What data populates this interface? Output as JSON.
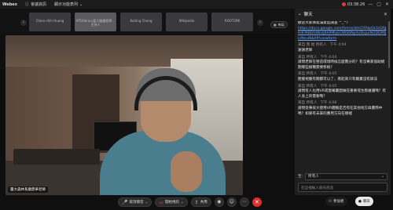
{
  "app": {
    "logo": "Webex",
    "menu_items": [
      "會議資訊",
      "顯示功能表列"
    ],
    "recording_time": "03:38:26",
    "window_controls": [
      "—",
      "▢",
      "✕"
    ]
  },
  "thumbnails": [
    {
      "name": "Chien-chih Huang"
    },
    {
      "name": "NTUlibrary臺大圖書館學...",
      "sub": "主持人"
    },
    {
      "name": "Kaiting Chang"
    },
    {
      "name": "Wikipedia"
    },
    {
      "name": "ROOT296"
    }
  ],
  "layout_button": "佈局",
  "video": {
    "name_tag": "臺大森林系康鼎華老師"
  },
  "toolbar": {
    "mute_label": "取消靜音",
    "video_label": "開始視訊",
    "share_label": "共用",
    "record_icon": "record-icon",
    "reactions_icon": "smile-icon",
    "more_icon": "more-icon",
    "end_icon": "end-call-icon"
  },
  "side_buttons": {
    "participants_label": "參加者",
    "chat_label": "聊天"
  },
  "chat": {
    "title": "聊天",
    "messages": [
      {
        "text": "歡迎大家填寫滿意度調查 ^_^/",
        "link": "https://docs.google.com/forms/d/e/1FAIpQLSd3fgR4FMBDfdWsIJ6h9MlyEOWS6NyhUDxpxMZDDMIjLtNsviNbAP/viewform"
      },
      {
        "text": "謝謝老師",
        "who": "來自 我 給 所有人",
        "when": "下午 4:04"
      },
      {
        "text": "請問老師在營造環境時候怎麼劃分的？有沒專家協助規劃哪些樹種需要移植？",
        "who": "來自 所有人",
        "when": "下午 4:04"
      },
      {
        "text": "聽覺視覺有關都可以了，看起來只有觸覺沒有辦法",
        "who": "來自 所有人",
        "when": "下午 4:05"
      },
      {
        "text": "請問有人也用VR或螢幕畫面做在重要或生態維護嗎？有人身上的需要嗎？",
        "who": "來自 所有人",
        "when": "下午 4:05"
      },
      {
        "text": "請問從事很大使用VR體驗是否有在其他地方與實際中嗎？如果有未來的應用方向在哪裡",
        "who": "來自 所有人",
        "when": "下午 4:06"
      }
    ],
    "to_label": "至:",
    "to_value": "所有人",
    "input_placeholder": "在這裡輸入聊天訊息"
  }
}
